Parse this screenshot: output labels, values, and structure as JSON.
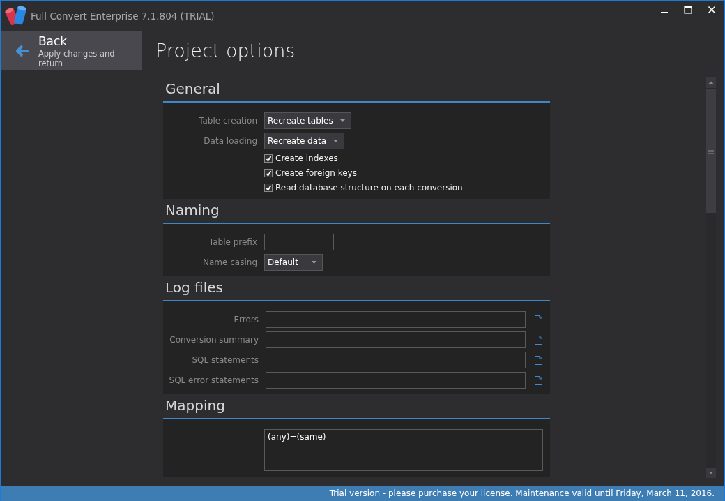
{
  "window": {
    "title": "Full Convert Enterprise 7.1.804 (TRIAL)"
  },
  "back": {
    "title": "Back",
    "subtitle": "Apply changes and return"
  },
  "page_title": "Project options",
  "sections": [
    {
      "title": "General",
      "rows": [
        {
          "kind": "select",
          "label": "Table creation",
          "value": "Recreate tables"
        },
        {
          "kind": "select",
          "label": "Data loading",
          "value": "Recreate data"
        },
        {
          "kind": "checkbox",
          "label": "Create indexes",
          "checked": true
        },
        {
          "kind": "checkbox",
          "label": "Create foreign keys",
          "checked": true
        },
        {
          "kind": "checkbox",
          "label": "Read database structure on each conversion",
          "checked": true
        }
      ]
    },
    {
      "title": "Naming",
      "rows": [
        {
          "kind": "text",
          "label": "Table prefix"
        },
        {
          "kind": "select",
          "label": "Name casing",
          "value": "Default"
        }
      ]
    },
    {
      "title": "Log files",
      "rows": [
        {
          "kind": "file",
          "label": "Errors"
        },
        {
          "kind": "file",
          "label": "Conversion summary"
        },
        {
          "kind": "file",
          "label": "SQL statements"
        },
        {
          "kind": "file",
          "label": "SQL error statements"
        }
      ]
    },
    {
      "title": "Mapping",
      "rows": [
        {
          "kind": "textarea",
          "value": "(any)=(same)"
        }
      ]
    }
  ],
  "status_bar": "Trial version - please purchase your license. Maintenance valid until Friday, March 11, 2016."
}
